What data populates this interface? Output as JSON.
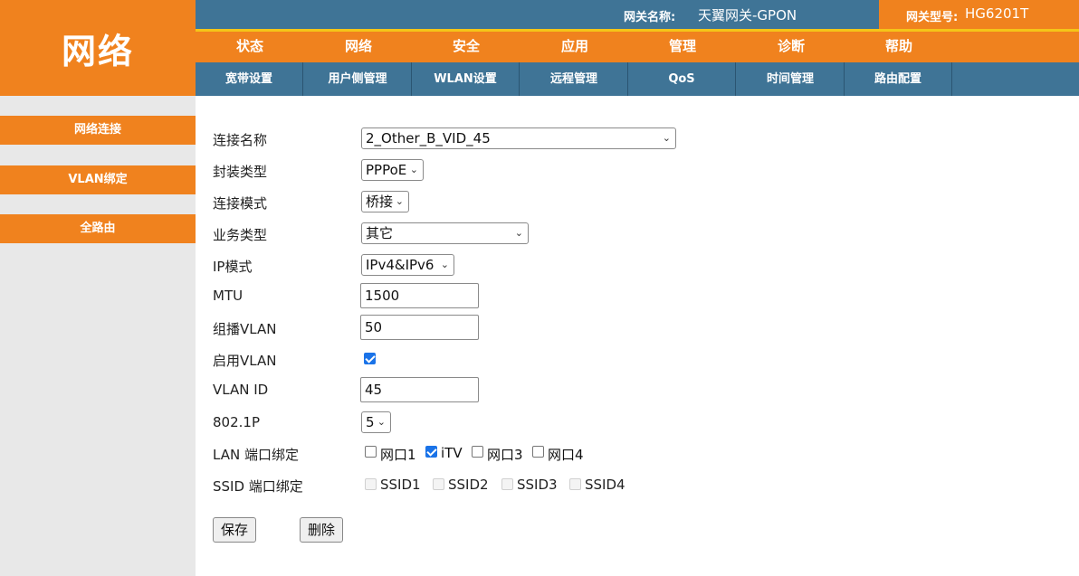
{
  "logo": "网络",
  "header": {
    "gateway_name_label": "网关名称:",
    "gateway_name": "天翼网关-GPON",
    "gateway_model_label": "网关型号:",
    "gateway_model": "HG6201T"
  },
  "main_nav": [
    "状态",
    "网络",
    "安全",
    "应用",
    "管理",
    "诊断",
    "帮助"
  ],
  "sub_nav": [
    "宽带设置",
    "用户侧管理",
    "WLAN设置",
    "远程管理",
    "QoS",
    "时间管理",
    "路由配置"
  ],
  "sidebar": [
    "网络连接",
    "VLAN绑定",
    "全路由"
  ],
  "form": {
    "connection_name_label": "连接名称",
    "connection_name": "2_Other_B_VID_45",
    "encap_label": "封装类型",
    "encap": "PPPoE",
    "mode_label": "连接模式",
    "mode": "桥接",
    "service_label": "业务类型",
    "service": "其它",
    "ip_mode_label": "IP模式",
    "ip_mode": "IPv4&IPv6",
    "mtu_label": "MTU",
    "mtu": "1500",
    "mcast_vlan_label": "组播VLAN",
    "mcast_vlan": "50",
    "enable_vlan_label": "启用VLAN",
    "enable_vlan": true,
    "vlan_id_label": "VLAN ID",
    "vlan_id": "45",
    "p8021_label": "802.1P",
    "p8021": "5",
    "lan_bind_label": "LAN 端口绑定",
    "lan_ports": [
      {
        "label": "网口1",
        "checked": false
      },
      {
        "label": "iTV",
        "checked": true
      },
      {
        "label": "网口3",
        "checked": false
      },
      {
        "label": "网口4",
        "checked": false
      }
    ],
    "ssid_bind_label": "SSID 端口绑定",
    "ssids": [
      {
        "label": "SSID1",
        "checked": false
      },
      {
        "label": "SSID2",
        "checked": false
      },
      {
        "label": "SSID3",
        "checked": false
      },
      {
        "label": "SSID4",
        "checked": false
      }
    ]
  },
  "buttons": {
    "save": "保存",
    "delete": "删除"
  },
  "icons": {
    "dropdown": "chevron-down-icon",
    "checkbox": "checkbox-icon"
  }
}
